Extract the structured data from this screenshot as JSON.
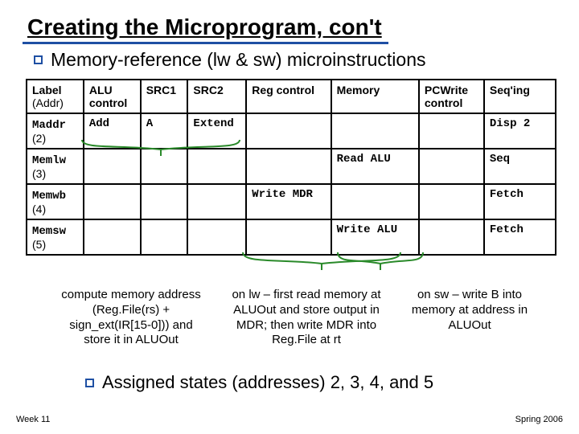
{
  "title": "Creating the Microprogram, con't",
  "subtitle": "Memory-reference (lw & sw) microinstructions",
  "headers": {
    "c0a": "Label",
    "c0b": "(Addr)",
    "c1": "ALU control",
    "c2": "SRC1",
    "c3": "SRC2",
    "c4": "Reg control",
    "c5": "Memory",
    "c6": "PCWrite control",
    "c7": "Seq'ing"
  },
  "rows": [
    {
      "label": "Maddr",
      "addr": "(2)",
      "alu": "Add",
      "src1": "A",
      "src2": "Extend",
      "reg": "",
      "mem": "",
      "pcw": "",
      "seq": "Disp 2"
    },
    {
      "label": "Memlw",
      "addr": "(3)",
      "alu": "",
      "src1": "",
      "src2": "",
      "reg": "",
      "mem": "Read ALU",
      "pcw": "",
      "seq": "Seq"
    },
    {
      "label": "Memwb",
      "addr": "(4)",
      "alu": "",
      "src1": "",
      "src2": "",
      "reg": "Write MDR",
      "mem": "",
      "pcw": "",
      "seq": "Fetch"
    },
    {
      "label": "Memsw",
      "addr": "(5)",
      "alu": "",
      "src1": "",
      "src2": "",
      "reg": "",
      "mem": "Write ALU",
      "pcw": "",
      "seq": "Fetch"
    }
  ],
  "notes": {
    "n1": "compute memory address (Reg.File(rs) + sign_ext(IR[15-0])) and store it in ALUOut",
    "n2": "on lw – first read memory at ALUOut and store output in MDR; then write MDR into Reg.File at rt",
    "n3": "on sw – write B into memory at address in ALUOut"
  },
  "assigned": "Assigned states (addresses) 2, 3, 4, and 5",
  "footer": {
    "left": "Week 11",
    "right": "Spring 2006"
  }
}
